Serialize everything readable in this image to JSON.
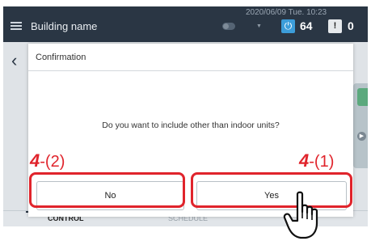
{
  "header": {
    "building_name": "Building name",
    "datetime": "2020/06/09 Tue. 10:23",
    "power_count": "64",
    "alert_count": "0",
    "icons": {
      "menu": "hamburger-menu-icon",
      "power": "power-icon",
      "alert": "warning-icon",
      "toggle": "toggle-icon"
    }
  },
  "dialog": {
    "title": "Confirmation",
    "message": "Do you want to include other than indoor units?",
    "no_label": "No",
    "yes_label": "Yes"
  },
  "tabs": {
    "control": "CONTROL",
    "schedule": "SCHEDULE"
  },
  "annotations": {
    "step_no_number": "4",
    "step_no_suffix": "-(2)",
    "step_yes_number": "4",
    "step_yes_suffix": "-(1)",
    "highlight_color": "#e0242c"
  },
  "colors": {
    "header_bg": "#2a3644",
    "power_badge": "#3c9dd9",
    "status_green": "#5ba97d"
  }
}
